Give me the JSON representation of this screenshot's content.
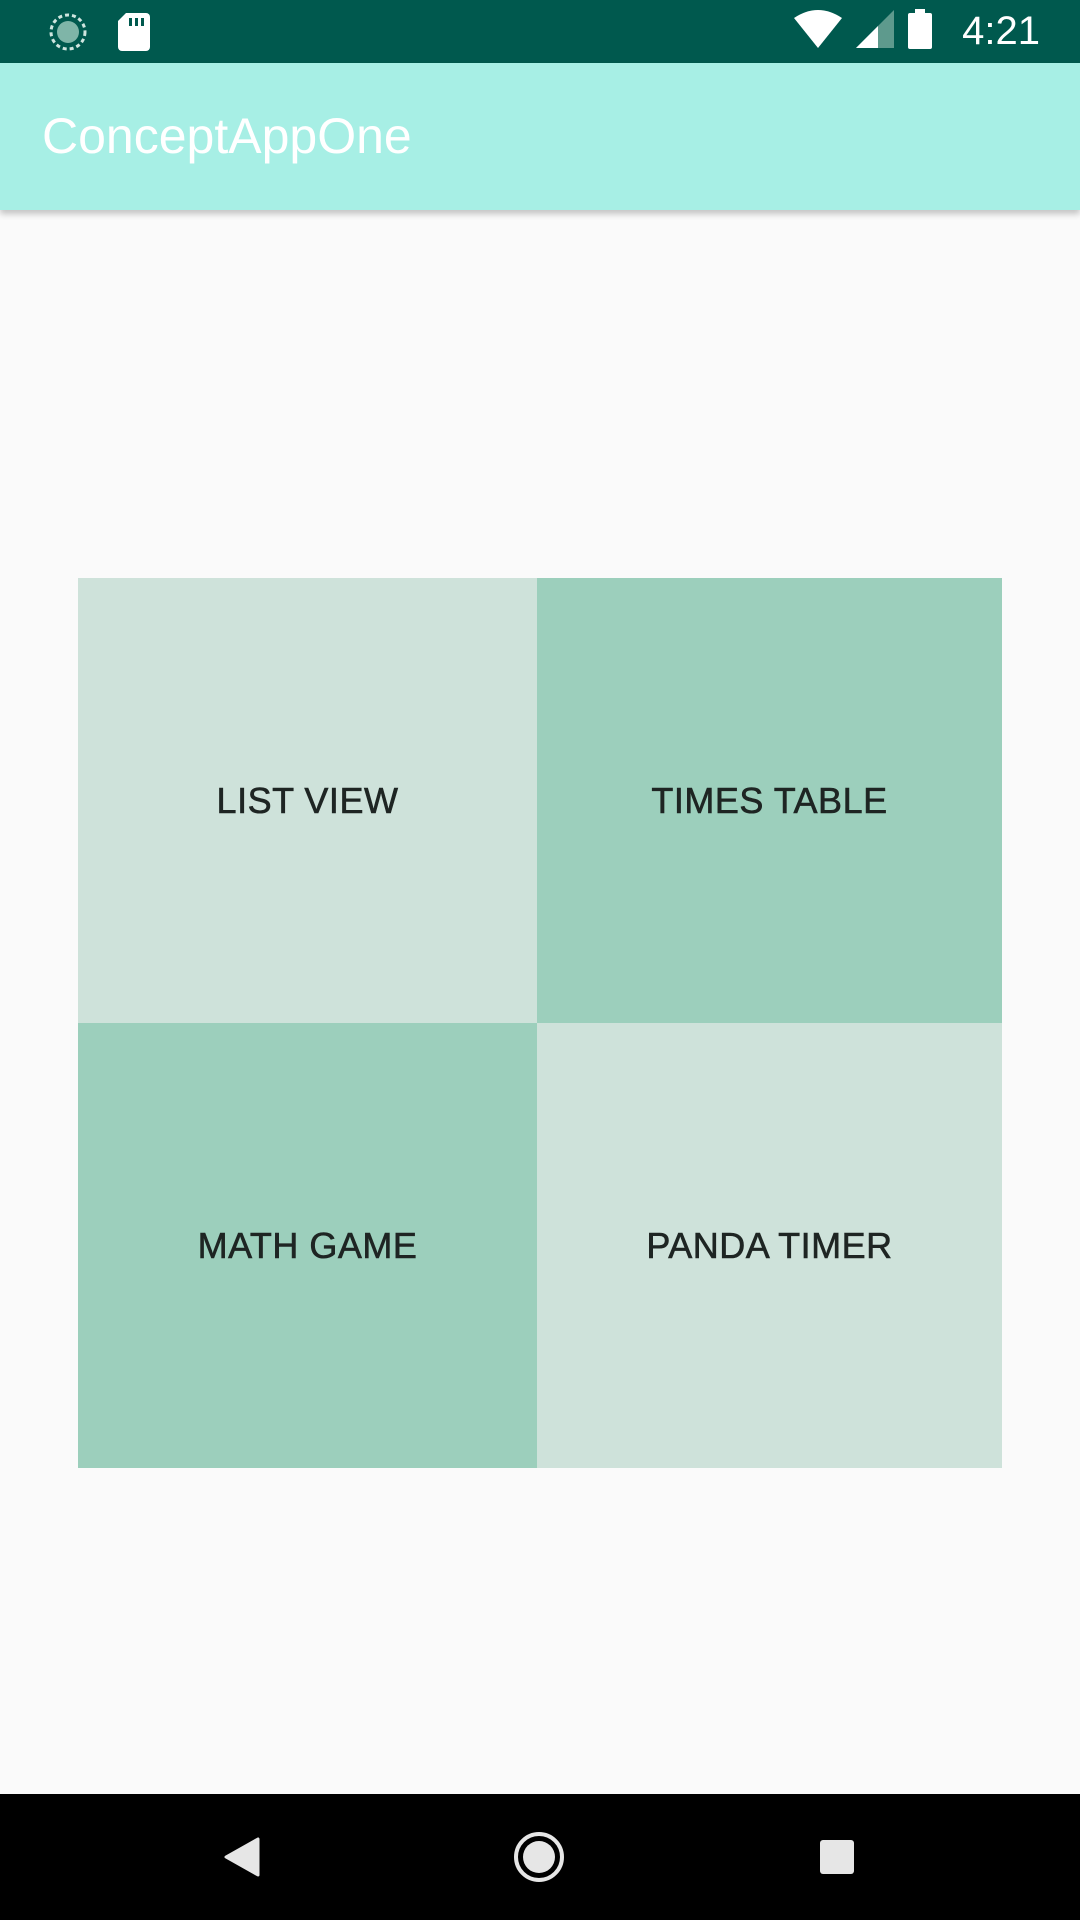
{
  "status_bar": {
    "time": "4:21",
    "icons": [
      "sync-icon",
      "sd-card-icon",
      "wifi-icon",
      "signal-icon",
      "battery-icon"
    ]
  },
  "app_bar": {
    "title": "ConceptAppOne",
    "color": "#a7efe5"
  },
  "menu": {
    "tiles": [
      {
        "label": "LIST VIEW",
        "color": "#cee2da"
      },
      {
        "label": "TIMES TABLE",
        "color": "#9ccfbc"
      },
      {
        "label": "MATH GAME",
        "color": "#9ccfbc"
      },
      {
        "label": "PANDA TIMER",
        "color": "#cee2da"
      }
    ]
  },
  "nav_bar": {
    "icons": [
      "back-icon",
      "home-icon",
      "recents-icon"
    ]
  }
}
